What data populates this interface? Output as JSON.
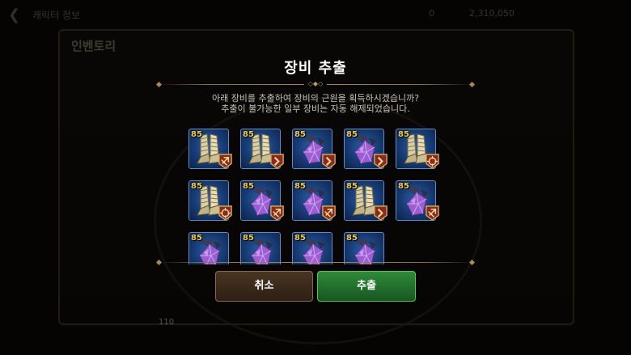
{
  "background": {
    "top_bar": {
      "back_icon": "chevron-left-icon",
      "title": "캐릭터 정보",
      "resources": [
        "0",
        "2,310,050"
      ]
    },
    "window_title": "인벤토리",
    "bottom_text": "110"
  },
  "dialog": {
    "title": "장비 추출",
    "message_line1": "아래 장비를 추출하여 장비의 근원을 획득하시겠습니까?",
    "message_line2": "추출이 불가능한 일부 장비는 자동 해제되었습니다.",
    "items": [
      {
        "level": "85",
        "type": "boots",
        "badge": "attack-badge-icon"
      },
      {
        "level": "85",
        "type": "boots",
        "badge": "speed-badge-icon"
      },
      {
        "level": "85",
        "type": "crystal",
        "badge": "speed-badge-icon"
      },
      {
        "level": "85",
        "type": "crystal",
        "badge": "speed-badge-icon"
      },
      {
        "level": "85",
        "type": "boots",
        "badge": "target-badge-icon"
      },
      {
        "level": "85",
        "type": "boots",
        "badge": "target-badge-icon"
      },
      {
        "level": "85",
        "type": "crystal",
        "badge": "attack-badge-icon"
      },
      {
        "level": "85",
        "type": "crystal",
        "badge": "attack-badge-icon"
      },
      {
        "level": "85",
        "type": "boots",
        "badge": "speed-badge-icon"
      },
      {
        "level": "85",
        "type": "crystal",
        "badge": "attack-badge-icon"
      },
      {
        "level": "85",
        "type": "crystal",
        "badge": "none"
      },
      {
        "level": "85",
        "type": "crystal",
        "badge": "none"
      },
      {
        "level": "85",
        "type": "crystal",
        "badge": "none"
      },
      {
        "level": "85",
        "type": "crystal",
        "badge": "none"
      }
    ],
    "cancel_label": "취소",
    "confirm_label": "추출"
  },
  "colors": {
    "accent_gold": "#a88a55",
    "level_text": "#f2c84b",
    "slot_blue": "#163a72",
    "confirm_green": "#2f8a3b",
    "cancel_brown": "#4a3523",
    "badge_red": "#8a2a1c"
  }
}
